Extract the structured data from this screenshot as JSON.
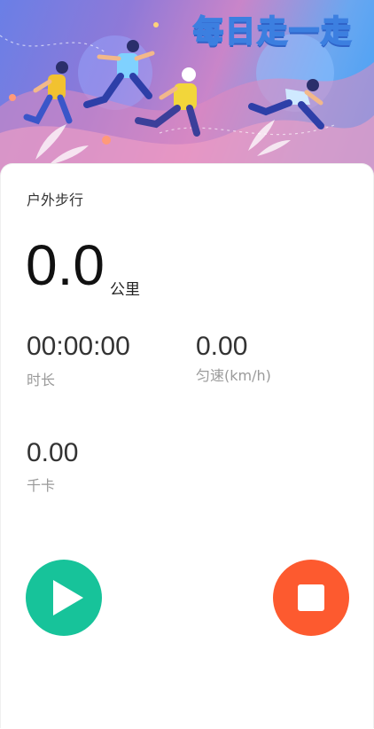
{
  "banner": {
    "title": "每日走一走",
    "colors": {
      "gradient_start": "#6a7fe6",
      "gradient_end": "#3fa0f7"
    }
  },
  "workout": {
    "mode_title": "户外步行",
    "distance": {
      "value": "0.0",
      "unit": "公里"
    },
    "duration": {
      "value": "00:00:00",
      "label": "时长"
    },
    "speed": {
      "value": "0.00",
      "label": "匀速(km/h)"
    },
    "calories": {
      "value": "0.00",
      "label": "千卡"
    }
  },
  "controls": {
    "start_icon": "play-icon",
    "stop_icon": "stop-icon",
    "start_color": "#17c39a",
    "stop_color": "#fd5a2f"
  }
}
